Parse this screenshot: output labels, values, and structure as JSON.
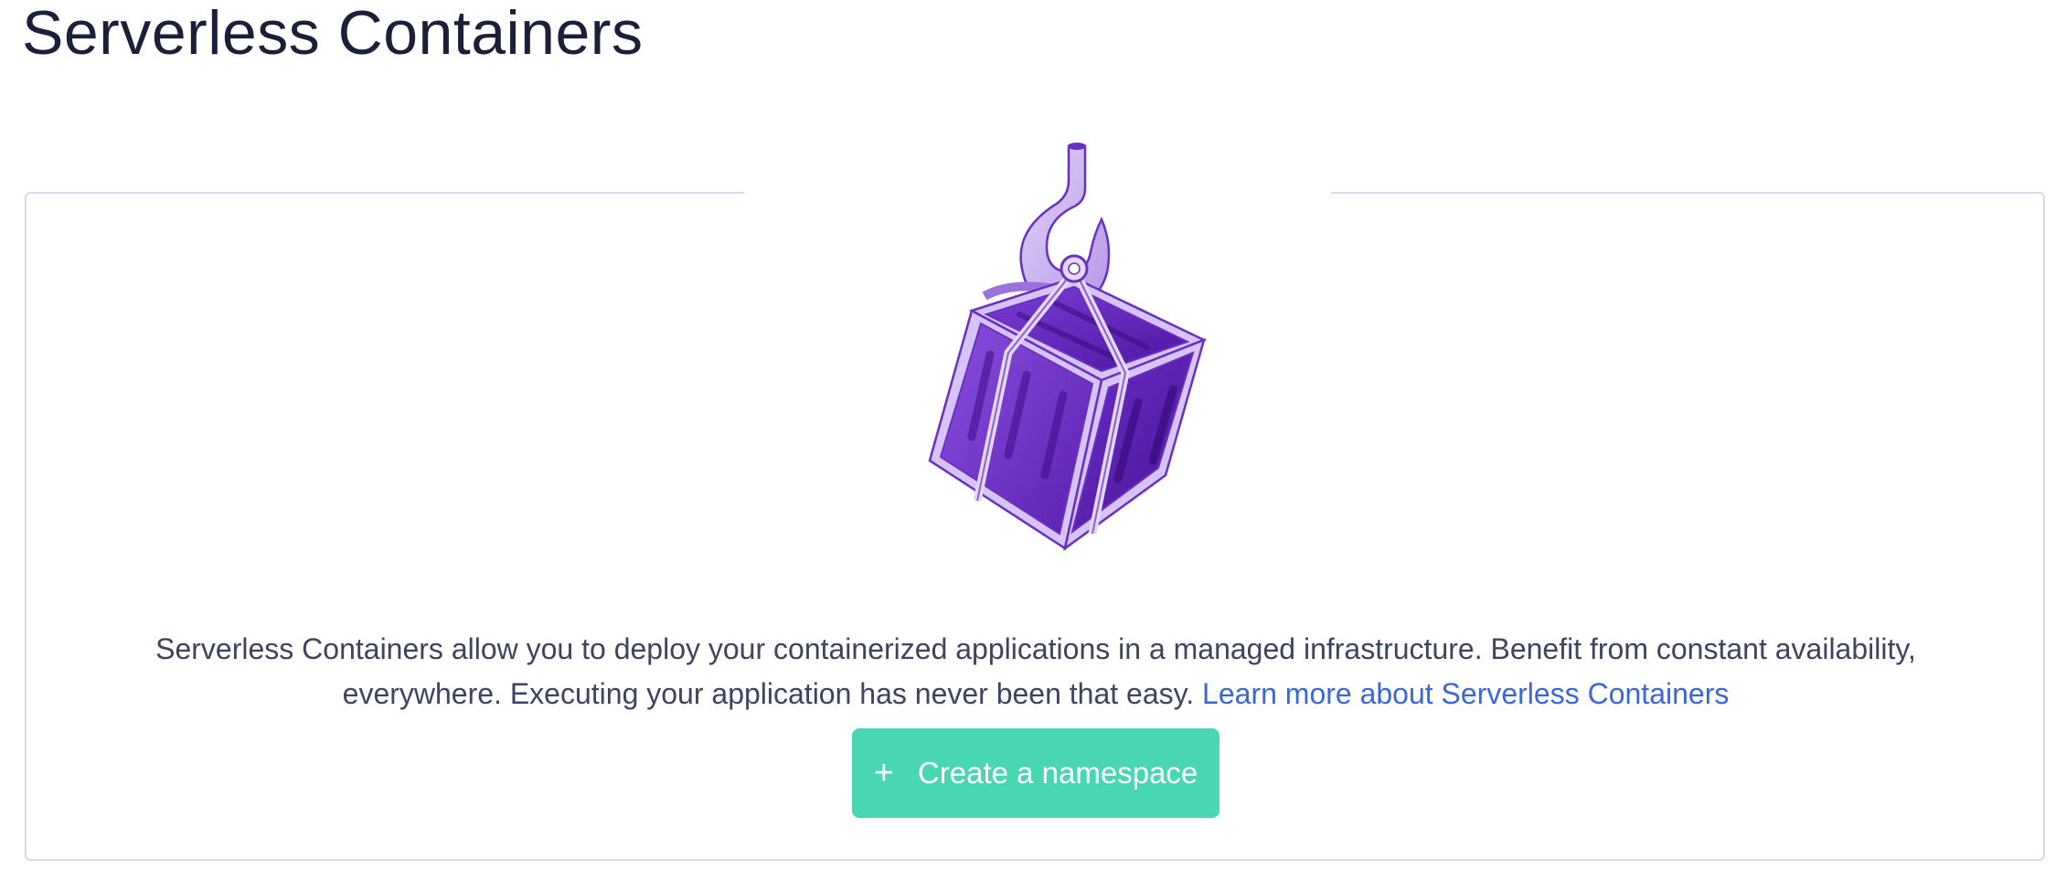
{
  "page": {
    "title": "Serverless Containers"
  },
  "empty_state": {
    "illustration_icon": "container-crate-icon",
    "description": "Serverless Containers allow you to deploy your containerized applications in a managed infrastructure. Benefit from constant availability, everywhere. Executing your application has never been that easy.",
    "learn_more_link": "Learn more about Serverless Containers",
    "create_button": {
      "icon": "plus-icon",
      "icon_glyph": "+",
      "label": "Create a namespace"
    }
  },
  "colors": {
    "title": "#1a1f3a",
    "text": "#3d4460",
    "link": "#3a66d8",
    "button_bg": "#48d6b3",
    "card_border": "#d6d9f2",
    "illustration_primary": "#6b2fc2",
    "illustration_light": "#c9b3ef"
  }
}
